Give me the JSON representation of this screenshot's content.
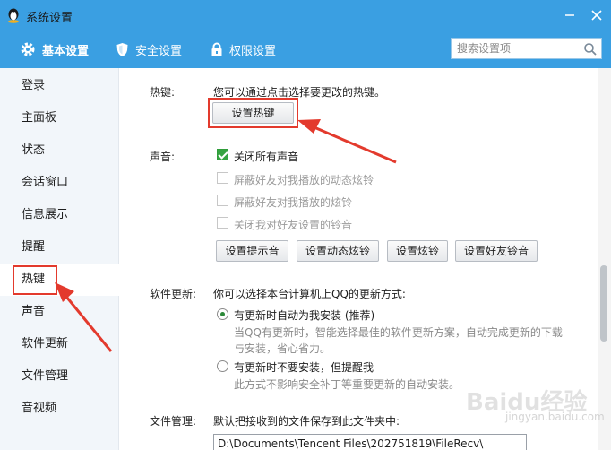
{
  "window": {
    "title": "系统设置"
  },
  "tabs": [
    {
      "label": "基本设置",
      "icon": "gear-icon"
    },
    {
      "label": "安全设置",
      "icon": "shield-icon"
    },
    {
      "label": "权限设置",
      "icon": "lock-icon"
    }
  ],
  "search": {
    "placeholder": "搜索设置项"
  },
  "sidebar": {
    "items": [
      {
        "label": "登录"
      },
      {
        "label": "主面板"
      },
      {
        "label": "状态"
      },
      {
        "label": "会话窗口"
      },
      {
        "label": "信息展示"
      },
      {
        "label": "提醒"
      },
      {
        "label": "热键",
        "active": true
      },
      {
        "label": "声音"
      },
      {
        "label": "软件更新"
      },
      {
        "label": "文件管理"
      },
      {
        "label": "音视频"
      }
    ]
  },
  "hotkey": {
    "label": "热键:",
    "description": "您可以通过点击选择要更改的热键。",
    "button": "设置热键"
  },
  "sound": {
    "label": "声音:",
    "options": [
      {
        "label": "关闭所有声音",
        "checked": true,
        "disabled": false
      },
      {
        "label": "屏蔽好友对我播放的动态炫铃",
        "checked": false,
        "disabled": true
      },
      {
        "label": "屏蔽好友对我播放的炫铃",
        "checked": false,
        "disabled": true
      },
      {
        "label": "关闭我对好友设置的铃音",
        "checked": false,
        "disabled": true
      }
    ],
    "buttons": [
      "设置提示音",
      "设置动态炫铃",
      "设置炫铃",
      "设置好友铃音"
    ]
  },
  "update": {
    "label": "软件更新:",
    "description": "你可以选择本台计算机上QQ的更新方式:",
    "option1": {
      "label": "有更新时自动为我安装 (推荐)",
      "desc_line1": "当QQ有更新时，智能选择最佳的软件更新方案，自动完成更新的下载",
      "desc_line2": "与安装，省心省力。"
    },
    "option2": {
      "label": "有更新时不要安装，但提醒我",
      "desc": "此方式不影响安全补丁等重要更新的自动安装。"
    }
  },
  "files": {
    "label": "文件管理:",
    "description": "默认把接收到的文件保存到此文件夹中:",
    "path": "D:\\Documents\\Tencent Files\\202751819\\FileRecv\\"
  },
  "watermark": {
    "text": "Baidu经验",
    "sub": "jingyan.baidu.com"
  },
  "colors": {
    "titlebar": "#3a9fe2",
    "accent_red": "#e33a2d",
    "check_green": "#36a341"
  }
}
